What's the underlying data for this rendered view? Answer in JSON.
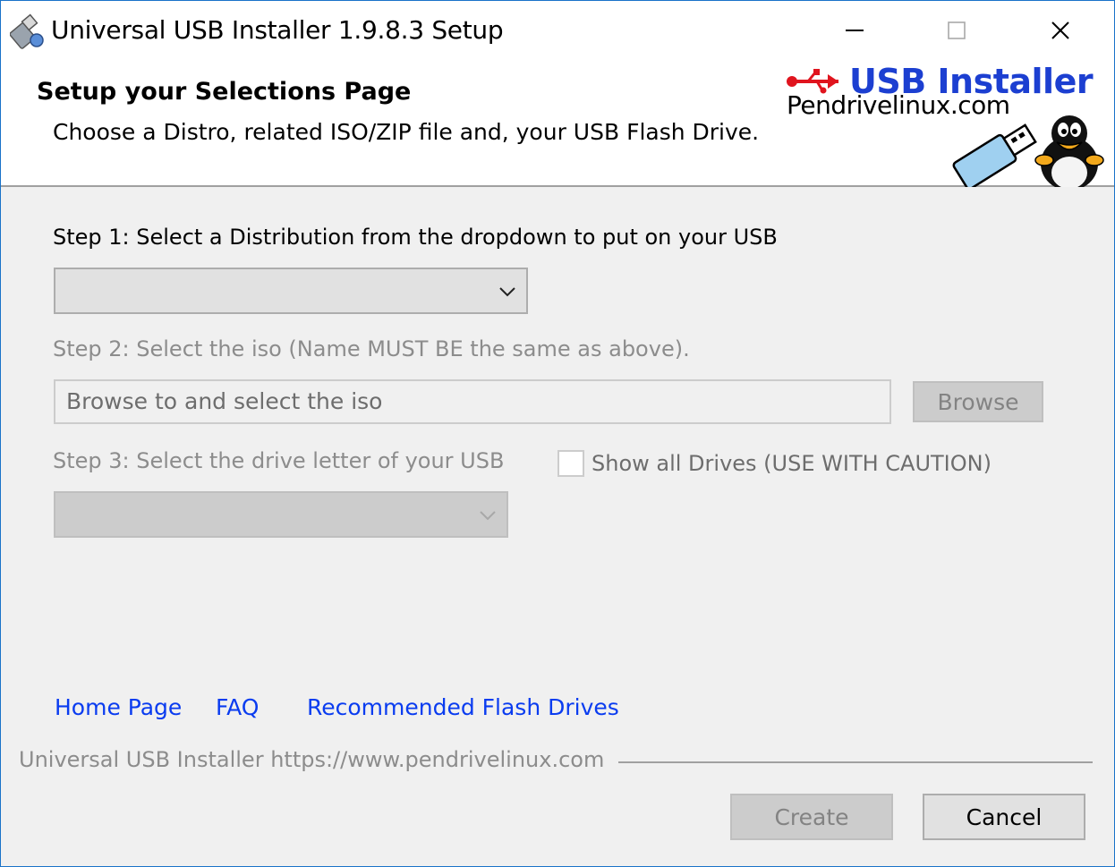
{
  "window": {
    "title": "Universal USB Installer 1.9.8.3 Setup",
    "controls": {
      "minimize": "minimize-icon",
      "maximize": "maximize-icon",
      "close": "close-icon"
    }
  },
  "header": {
    "title": "Setup your Selections Page",
    "subtitle": "Choose a Distro, related ISO/ZIP file and, your USB Flash Drive.",
    "logo": {
      "title": "USB Installer",
      "subtitle": "Pendrivelinux.com"
    }
  },
  "step1": {
    "label": "Step 1: Select a Distribution from the dropdown to put on your USB",
    "selected": ""
  },
  "step2": {
    "label": "Step 2: Select the iso (Name MUST BE the same as above).",
    "input_value": "Browse to and select the iso",
    "browse_label": "Browse"
  },
  "step3": {
    "label": "Step 3: Select the drive letter of your USB",
    "selected": "",
    "show_all_label": "Show all Drives (USE WITH CAUTION)",
    "show_all_checked": false
  },
  "links": {
    "home": "Home Page",
    "faq": "FAQ",
    "recommended": "Recommended Flash Drives"
  },
  "footer": {
    "branding": "Universal USB Installer https://www.pendrivelinux.com",
    "create_label": "Create",
    "cancel_label": "Cancel"
  },
  "colors": {
    "link": "#0a3cf0",
    "logo_title": "#1c3fd1",
    "usb_symbol": "#e0141e",
    "disabled_text": "#8c8c8c",
    "window_border": "#1a73c9"
  }
}
